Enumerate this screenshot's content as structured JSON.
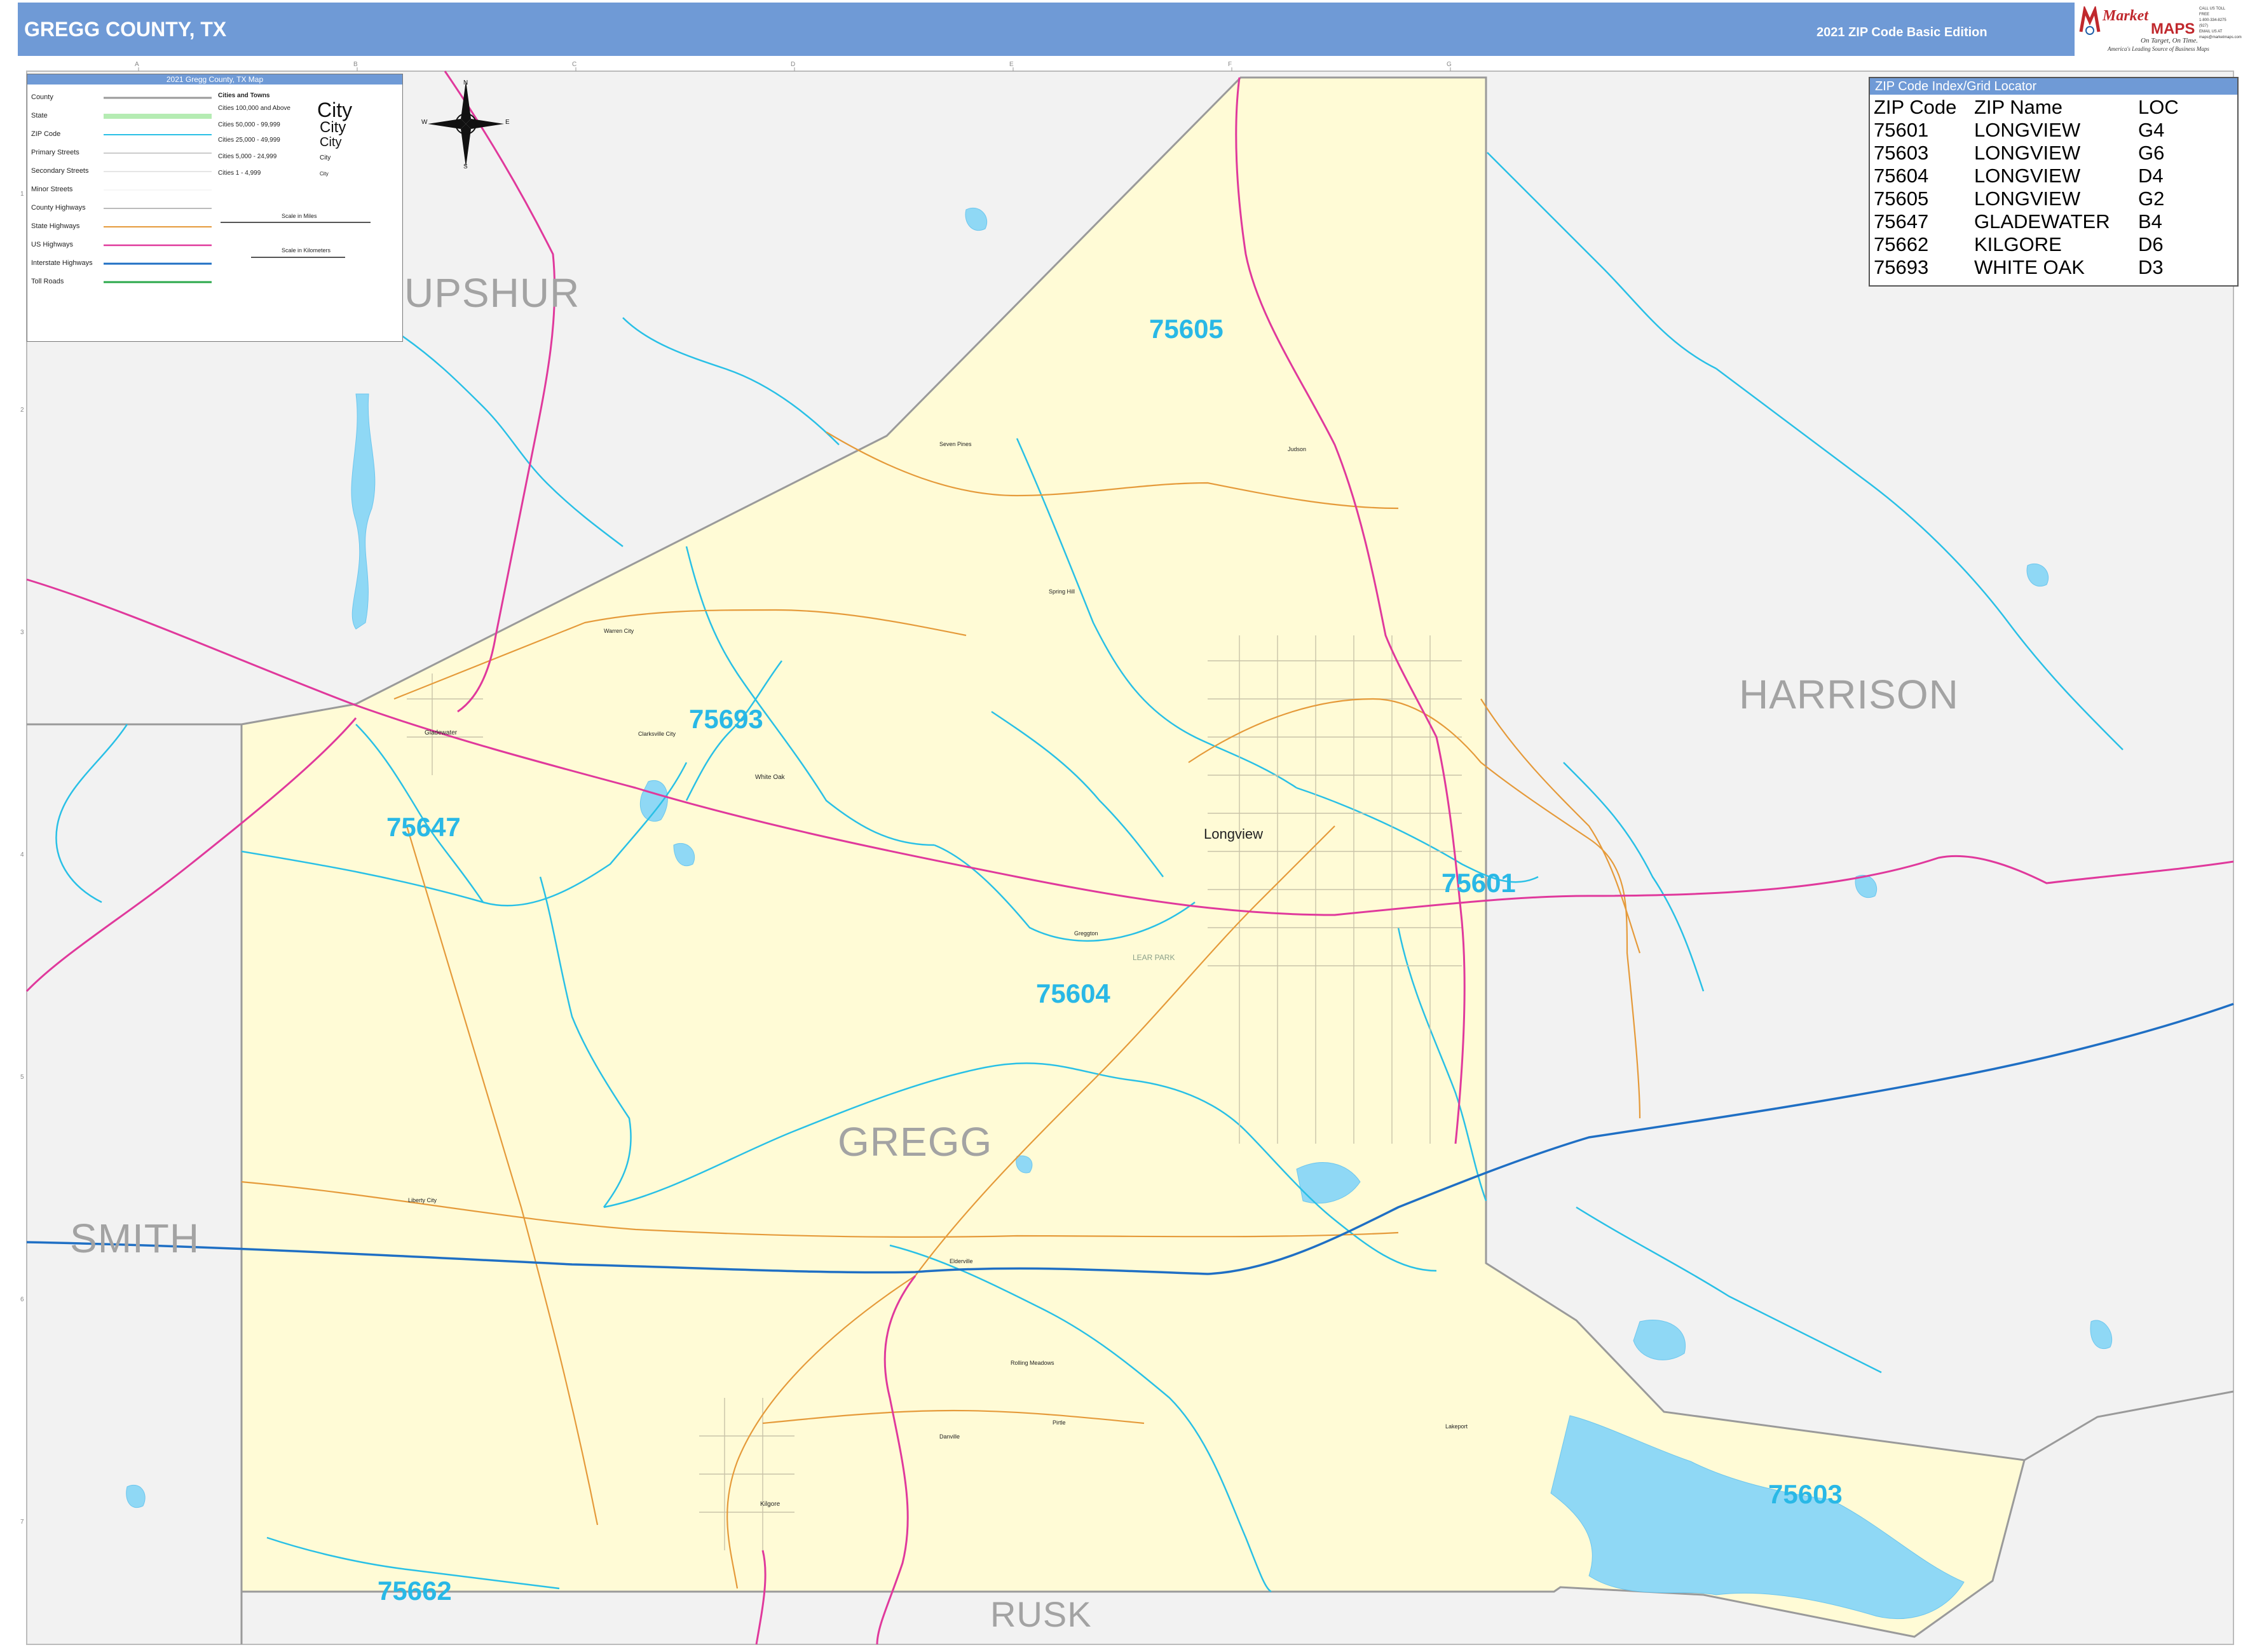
{
  "header": {
    "title": "GREGG COUNTY, TX",
    "edition": "2021 ZIP Code Basic Edition"
  },
  "logo": {
    "brand_m": "Market",
    "brand_maps": "MAPS",
    "tagline": "On Target, On Time.",
    "subtagline": "America's Leading Source of Business Maps",
    "contact": [
      "CALL US TOLL FREE",
      "1-800-334-8275 (927)",
      "EMAIL US AT",
      "maps@marketmaps.com"
    ]
  },
  "legend": {
    "title": "2021 Gregg County, TX Map",
    "items": [
      "County",
      "State",
      "ZIP Code",
      "Primary Streets",
      "Secondary Streets",
      "Minor Streets",
      "County Highways",
      "State Highways",
      "US Highways",
      "Interstate Highways",
      "Toll Roads"
    ],
    "cities_header": "Cities and Towns",
    "city_sizes": [
      "Cities 100,000 and Above",
      "Cities 50,000 - 99,999",
      "Cities 25,000 - 49,999",
      "Cities 5,000 - 24,999",
      "Cities 1 - 4,999"
    ],
    "city_samples": [
      "City",
      "City",
      "City",
      "City",
      "City"
    ],
    "scale_miles": "Scale in Miles",
    "scale_km": "Scale in Kilometers",
    "compass": [
      "N",
      "S",
      "E",
      "W"
    ]
  },
  "zip_index": {
    "title": "ZIP Code Index/Grid Locator",
    "columns": [
      "ZIP Code",
      "ZIP Name",
      "LOC"
    ],
    "rows": [
      [
        "75601",
        "LONGVIEW",
        "G4"
      ],
      [
        "75603",
        "LONGVIEW",
        "G6"
      ],
      [
        "75604",
        "LONGVIEW",
        "D4"
      ],
      [
        "75605",
        "LONGVIEW",
        "G2"
      ],
      [
        "75647",
        "GLADEWATER",
        "B4"
      ],
      [
        "75662",
        "KILGORE",
        "D6"
      ],
      [
        "75693",
        "WHITE OAK",
        "D3"
      ]
    ]
  },
  "counties": {
    "upshur": "UPSHUR",
    "harrison": "HARRISON",
    "smith": "SMITH",
    "gregg": "GREGG",
    "rusk": "RUSK"
  },
  "zips": {
    "z75605": "75605",
    "z75693": "75693",
    "z75647": "75647",
    "z75601": "75601",
    "z75604": "75604",
    "z75603": "75603",
    "z75662": "75662"
  },
  "cities": {
    "longview": "Longview",
    "gladewater": "Gladewater",
    "white_oak": "White Oak",
    "clarksville_city": "Clarksville City",
    "warren_city": "Warren City",
    "spring_hill": "Spring Hill",
    "judson": "Judson",
    "seven_pines": "Seven Pines",
    "greggton": "Greggton",
    "lear_park": "LEAR PARK",
    "liberty_city": "Liberty City",
    "kilgore": "Kilgore",
    "easton": "Elderville",
    "rolling_meadows": "Rolling Meadows",
    "danville": "Danville",
    "pirtle": "Pirtle",
    "lakeport": "Lakeport"
  },
  "grid": {
    "columns": [
      "A",
      "B",
      "C",
      "D",
      "E",
      "F",
      "G"
    ],
    "rows": [
      "1",
      "2",
      "3",
      "4",
      "5",
      "6",
      "7"
    ]
  },
  "colors": {
    "header": "#6f9ad6",
    "county_fill": "#fffbd6",
    "outside_fill": "#f2f2f2",
    "zip_line": "#29c0e6",
    "interstate": "#1f6fc4",
    "us_highway": "#e0399c",
    "state_highway": "#e59a3a",
    "water": "#8fd8f5",
    "county_border": "#9a9a9a"
  }
}
